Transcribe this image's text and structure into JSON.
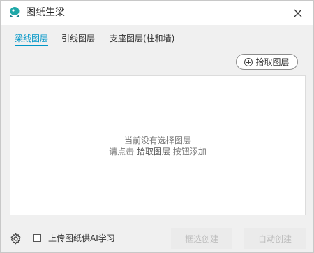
{
  "window": {
    "title": "图纸生梁",
    "close_icon": "close-icon",
    "app_icon": "logo-icon"
  },
  "tabs": [
    {
      "label": "梁线图层",
      "active": true
    },
    {
      "label": "引线图层",
      "active": false
    },
    {
      "label": "支座图层(柱和墙)",
      "active": false
    }
  ],
  "toolbar": {
    "pick_layer_label": "拾取图层",
    "pick_layer_icon": "plus-circle-icon"
  },
  "panel": {
    "empty_line1": "当前没有选择图层",
    "empty_prefix": "请点击 ",
    "empty_link": "拾取图层",
    "empty_suffix": " 按钮添加"
  },
  "footer": {
    "settings_icon": "gear-icon",
    "upload_label": "上传图纸供AI学习",
    "upload_checked": false,
    "box_create_label": "框选创建",
    "auto_create_label": "自动创建"
  },
  "colors": {
    "accent": "#0096c7",
    "disabled_bg": "#ebebeb",
    "disabled_text": "#bdbdbd"
  }
}
